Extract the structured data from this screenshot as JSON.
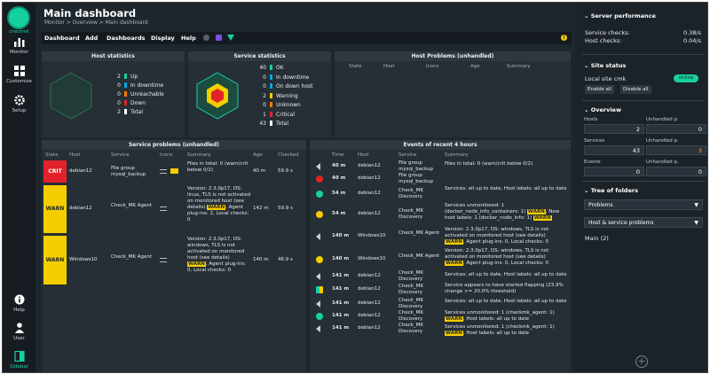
{
  "app": {
    "logo_text": "checkmk"
  },
  "nav": [
    {
      "label": "Monitor",
      "icon": "monitor-icon"
    },
    {
      "label": "Customize",
      "icon": "customize-icon"
    },
    {
      "label": "Setup",
      "icon": "setup-icon"
    },
    {
      "label": "Help",
      "icon": "help-icon"
    },
    {
      "label": "User",
      "icon": "user-icon"
    },
    {
      "label": "Sidebar",
      "icon": "sidebar-icon"
    }
  ],
  "header": {
    "title": "Main dashboard",
    "breadcrumb": "Monitor > Overview > Main dashboard"
  },
  "menu": [
    "Dashboard",
    "Add",
    "Dashboards",
    "Display",
    "Help"
  ],
  "host_stats": {
    "title": "Host statistics",
    "items": [
      {
        "count": "2",
        "label": "Up",
        "color": "#15d1a0"
      },
      {
        "count": "0",
        "label": "In downtime",
        "color": "#00a6e0"
      },
      {
        "count": "0",
        "label": "Unreachable",
        "color": "#ff7a00"
      },
      {
        "count": "0",
        "label": "Down",
        "color": "#e2222a"
      },
      {
        "count": "2",
        "label": "Total",
        "color": "#ffffff"
      }
    ]
  },
  "service_stats": {
    "title": "Service statistics",
    "items": [
      {
        "count": "40",
        "label": "OK",
        "color": "#15d1a0"
      },
      {
        "count": "0",
        "label": "In downtime",
        "color": "#00a6e0"
      },
      {
        "count": "0",
        "label": "On down host",
        "color": "#00a6e0"
      },
      {
        "count": "2",
        "label": "Warning",
        "color": "#f5ce00"
      },
      {
        "count": "0",
        "label": "Unknown",
        "color": "#ff7a00"
      },
      {
        "count": "1",
        "label": "Critical",
        "color": "#e2222a"
      },
      {
        "count": "43",
        "label": "Total",
        "color": "#ffffff"
      }
    ]
  },
  "host_problems": {
    "title": "Host Problems (unhandled)",
    "columns": [
      "State",
      "Host",
      "Icons",
      "Age",
      "Summary"
    ]
  },
  "service_problems": {
    "title": "Service problems (unhandled)",
    "columns": [
      "State",
      "Host",
      "Service",
      "Icons",
      "Summary",
      "Age",
      "Checked"
    ],
    "rows": [
      {
        "state": "CRIT",
        "host": "debian12",
        "service": "File group mysql_backup",
        "summary": "Files in total: 0 (warn/crit below 0/2)",
        "age": "40 m",
        "checked": "59.9 s"
      },
      {
        "state": "WARN",
        "host": "debian12",
        "service": "Check_MK Agent",
        "summary": "Version: 2.3.0p17, OS: linux, TLS is not activated on monitored host (see details) WARN, Agent plug-ins: 2, Local checks: 0",
        "age": "142 m",
        "checked": "59.9 s"
      },
      {
        "state": "WARN",
        "host": "Windows10",
        "service": "Check_MK Agent",
        "summary": "Version: 2.3.0p17, OS: windows, TLS is not activated on monitored host (see details) WARN, Agent plug-ins: 0, Local checks: 0",
        "age": "140 m",
        "checked": "46.9 s"
      }
    ]
  },
  "events": {
    "title": "Events of recent 4 hours",
    "columns": [
      "Time",
      "Host",
      "Service",
      "Summary"
    ],
    "rows": [
      {
        "icon": "speaker",
        "time": "40 m",
        "host": "debian12",
        "service": "File group mysql_backup",
        "summary": "Files in total: 0 (warn/crit below 0/2)"
      },
      {
        "icon": "crit",
        "time": "40 m",
        "host": "debian12",
        "service": "File group mysql_backup",
        "summary": ""
      },
      {
        "icon": "ok",
        "time": "54 m",
        "host": "debian12",
        "service": "Check_MK Discovery",
        "summary": "Services: all up to date, Host labels: all up to date"
      },
      {
        "icon": "warn",
        "time": "54 m",
        "host": "debian12",
        "service": "Check_MK Discovery",
        "summary": "Services unmonitored: 1 (docker_node_info_containers: 1) WARN, New host labels: 1 (docker_node_info: 1) WARN"
      },
      {
        "icon": "speaker",
        "time": "140 m",
        "host": "Windows10",
        "service": "Check_MK Agent",
        "summary": "Version: 2.3.0p17, OS: windows, TLS is not activated on monitored host (see details) WARN, Agent plug-ins: 0, Local checks: 0"
      },
      {
        "icon": "warn",
        "time": "140 m",
        "host": "Windows10",
        "service": "Check_MK Agent",
        "summary": "Version: 2.3.0p17, OS: windows, TLS is not activated on monitored host (see details) WARN, Agent plug-ins: 0, Local checks: 0"
      },
      {
        "icon": "speaker",
        "time": "141 m",
        "host": "debian12",
        "service": "Check_MK Discovery",
        "summary": "Services: all up to date, Host labels: all up to date"
      },
      {
        "icon": "flap",
        "time": "141 m",
        "host": "debian12",
        "service": "Check_MK Discovery",
        "summary": "Service appears to have started flapping (23.9% change >= 20.0% threshold)"
      },
      {
        "icon": "speaker",
        "time": "141 m",
        "host": "debian12",
        "service": "Check_MK Discovery",
        "summary": "Services: all up to date, Host labels: all up to date"
      },
      {
        "icon": "ok",
        "time": "141 m",
        "host": "debian12",
        "service": "Check_MK Discovery",
        "summary": "Services unmonitored: 1 (checkmk_agent: 1) WARN, Host labels: all up to date"
      },
      {
        "icon": "speaker",
        "time": "141 m",
        "host": "debian12",
        "service": "Check_MK Discovery",
        "summary": "Services unmonitored: 1 (checkmk_agent: 1) WARN, Host labels: all up to date"
      }
    ]
  },
  "sidebar": {
    "server_performance": {
      "title": "Server performance",
      "service_checks_label": "Service checks:",
      "service_checks_value": "0.38/s",
      "host_checks_label": "Host checks:",
      "host_checks_value": "0.04/s"
    },
    "site_status": {
      "title": "Site status",
      "site": "Local site cmk",
      "status": "online",
      "enable_all": "Enable all",
      "disable_all": "Disable all"
    },
    "overview": {
      "title": "Overview",
      "cells": [
        {
          "label": "Hosts",
          "value": "2",
          "accent": ""
        },
        {
          "label": "Unhandled p.",
          "value": "0",
          "accent": ""
        },
        {
          "label": "Services",
          "value": "43",
          "accent": ""
        },
        {
          "label": "Unhandled p.",
          "value": "3",
          "accent": "#f5a623"
        },
        {
          "label": "Events",
          "value": "0",
          "accent": ""
        },
        {
          "label": "Unhandled p.",
          "value": "0",
          "accent": ""
        }
      ]
    },
    "tree": {
      "title": "Tree of folders",
      "select1": "Problems",
      "select2": "Host & service problems",
      "item": "Main (2)"
    }
  }
}
